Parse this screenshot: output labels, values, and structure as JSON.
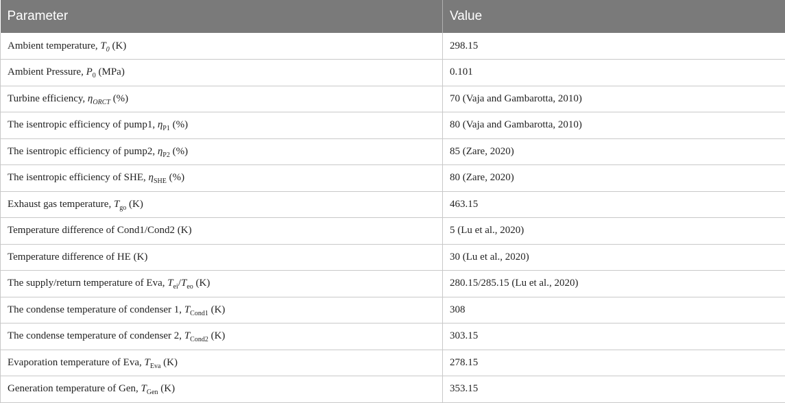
{
  "header": {
    "parameter": "Parameter",
    "value": "Value"
  },
  "rows": [
    {
      "label": "Ambient temperature, ",
      "sym": "T",
      "sub": "0",
      "unit": " (K)",
      "value": "298.15"
    },
    {
      "label": "Ambient Pressure, ",
      "sym": "P",
      "sub": "0",
      "unit": " (MPa)",
      "value": "0.101"
    },
    {
      "label": "Turbine efficiency, ",
      "sym": "η",
      "sub": "ORCT",
      "unit": " (%)",
      "value": "70 (Vaja and Gambarotta, 2010)"
    },
    {
      "label": "The isentropic efficiency of pump1, ",
      "sym": "η",
      "sub": "P1",
      "unit": " (%)",
      "value": "80 (Vaja and Gambarotta, 2010)"
    },
    {
      "label": "The isentropic efficiency of pump2, ",
      "sym": "η",
      "sub": "P2",
      "unit": " (%)",
      "value": "85 (Zare, 2020)"
    },
    {
      "label": "The isentropic efficiency of SHE, ",
      "sym": "η",
      "sub": "SHE",
      "unit": " (%)",
      "value": "80 (Zare, 2020)"
    },
    {
      "label": "Exhaust gas temperature, ",
      "sym": "T",
      "sub": "go",
      "unit": " (K)",
      "value": "463.15"
    },
    {
      "label": "Temperature difference of Cond1/Cond2 (K)",
      "sym": "",
      "sub": "",
      "unit": "",
      "value": "5 (Lu et al., 2020)"
    },
    {
      "label": "Temperature difference of HE (K)",
      "sym": "",
      "sub": "",
      "unit": "",
      "value": "30 (Lu et al., 2020)"
    },
    {
      "label": "The supply/return temperature of Eva, ",
      "sym": "T",
      "sub": "ei",
      "sym2": "T",
      "sub2": "eo",
      "unit": " (K)",
      "value": "280.15/285.15 (Lu et al., 2020)"
    },
    {
      "label": "The condense temperature of condenser 1, ",
      "sym": "T",
      "sub": "Cond1",
      "unit": " (K)",
      "value": "308"
    },
    {
      "label": "The condense temperature of condenser 2, ",
      "sym": "T",
      "sub": "Cond2",
      "unit": " (K)",
      "value": "303.15"
    },
    {
      "label": "Evaporation temperature of Eva, ",
      "sym": "T",
      "sub": "Eva",
      "unit": " (K)",
      "value": "278.15"
    },
    {
      "label": "Generation temperature of Gen, ",
      "sym": "T",
      "sub": "Gen",
      "unit": " (K)",
      "value": "353.15"
    }
  ]
}
